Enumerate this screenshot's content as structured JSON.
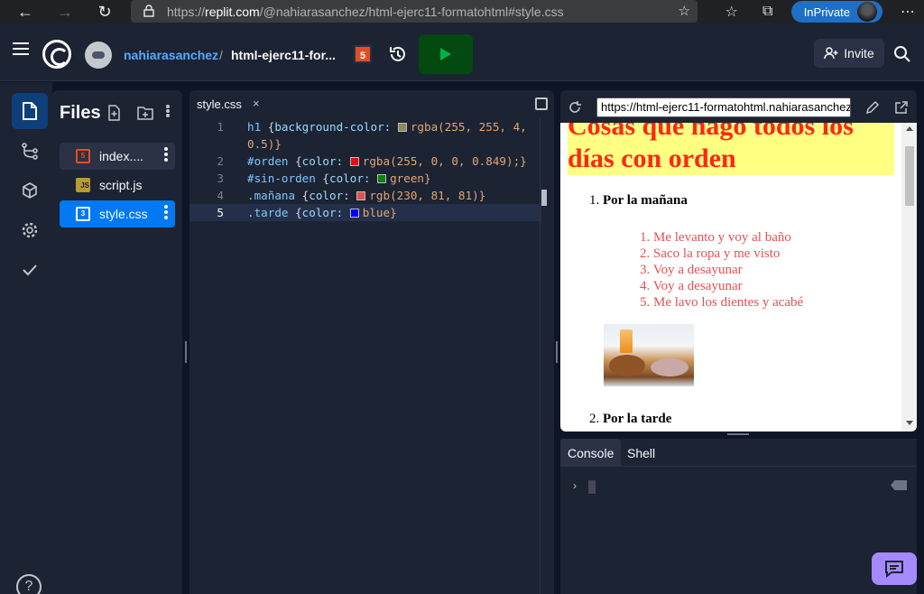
{
  "browser": {
    "url_prefix": "https://",
    "url_host": "replit.com",
    "url_path": "/@nahiarasanchez/html-ejerc11-formatohtml#style.css",
    "inprivate_label": "InPrivate"
  },
  "topbar": {
    "username": "nahiarasanchez",
    "separator": "/",
    "repl_name": "html-ejerc11-for...",
    "language_badge": "5",
    "invite_label": "Invite"
  },
  "files": {
    "title": "Files",
    "items": [
      {
        "name": "index....",
        "icon": "html-file-icon",
        "state": "hover"
      },
      {
        "name": "script.js",
        "icon": "js-file-icon",
        "state": "normal"
      },
      {
        "name": "style.css",
        "icon": "css-file-icon",
        "state": "selected"
      }
    ]
  },
  "editor": {
    "tab_label": "style.css",
    "tab_close": "×",
    "line_numbers": [
      "1",
      "",
      "2",
      "3",
      "4",
      "5"
    ],
    "current_line": "5",
    "lines": [
      {
        "selector": "h1",
        "property": "background-color:",
        "swatch": "#8a8a5a",
        "value": "rgba(255, 255, 4,"
      },
      {
        "continuation": "0.5)}"
      },
      {
        "selector": "#orden",
        "property": "color:",
        "swatch": "#e01010",
        "value": "rgba(255, 0, 0, 0.849);}"
      },
      {
        "selector": "#sin-orden",
        "property": "color:",
        "swatch": "#108010",
        "value": "green}"
      },
      {
        "selector": ".mañana",
        "property": "color:",
        "swatch": "#e05151",
        "value": "rgb(230, 81, 81)}"
      },
      {
        "selector": ".tarde",
        "property": "color:",
        "swatch": "#0000ff",
        "value": "blue}"
      }
    ]
  },
  "webview": {
    "url": "https://html-ejerc11-formatohtml.nahiarasanchez",
    "heading_line1": "Cosas que hago todos los",
    "heading_line2": "días con orden",
    "section1_number": "1.",
    "section1_title": "Por la mañana",
    "morning_items": [
      "Me levanto y voy al baño",
      "Saco la ropa y me visto",
      "Voy a desayunar",
      "Voy a desayunar",
      "Me lavo los dientes y acabé"
    ],
    "section2_number": "2.",
    "section2_title": "Por la tarde"
  },
  "console": {
    "tabs": [
      "Console",
      "Shell"
    ],
    "active_tab": "Console",
    "prompt": "›"
  },
  "colors": {
    "accent": "#0079f2",
    "run_bg": "#044a10",
    "run_icon": "#00b247",
    "heading_bg": "rgba(255,255,4,0.5)",
    "heading_text": "rgba(255,0,0,0.849)",
    "morning_text": "rgb(230,81,81)"
  }
}
